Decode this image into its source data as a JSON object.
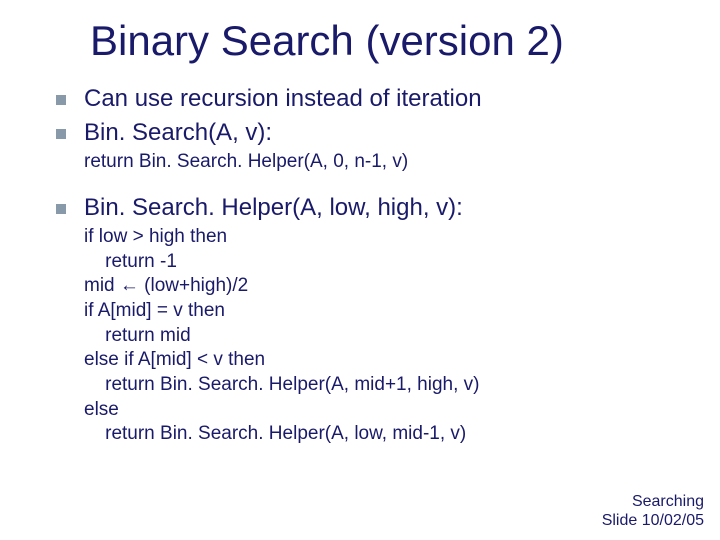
{
  "title": "Binary Search (version 2)",
  "bullets": {
    "b1": "Can use recursion instead of iteration",
    "b2": "Bin. Search(A, v):",
    "b2_sub": "return Bin. Search. Helper(A, 0, n-1, v)",
    "b3": "Bin. Search. Helper(A, low, high, v):"
  },
  "code": {
    "l1": "if low > high then",
    "l2": "    return -1",
    "l3": "mid ← (low+high)/2",
    "l4": "if A[mid] = v then",
    "l5": "    return mid",
    "l6": "else if A[mid] < v then",
    "l7": "    return Bin. Search. Helper(A, mid+1, high, v)",
    "l8": "else",
    "l9": "    return Bin. Search. Helper(A, low, mid-1, v)"
  },
  "footer": {
    "line1": "Searching",
    "line2": "Slide 10/02/05"
  }
}
